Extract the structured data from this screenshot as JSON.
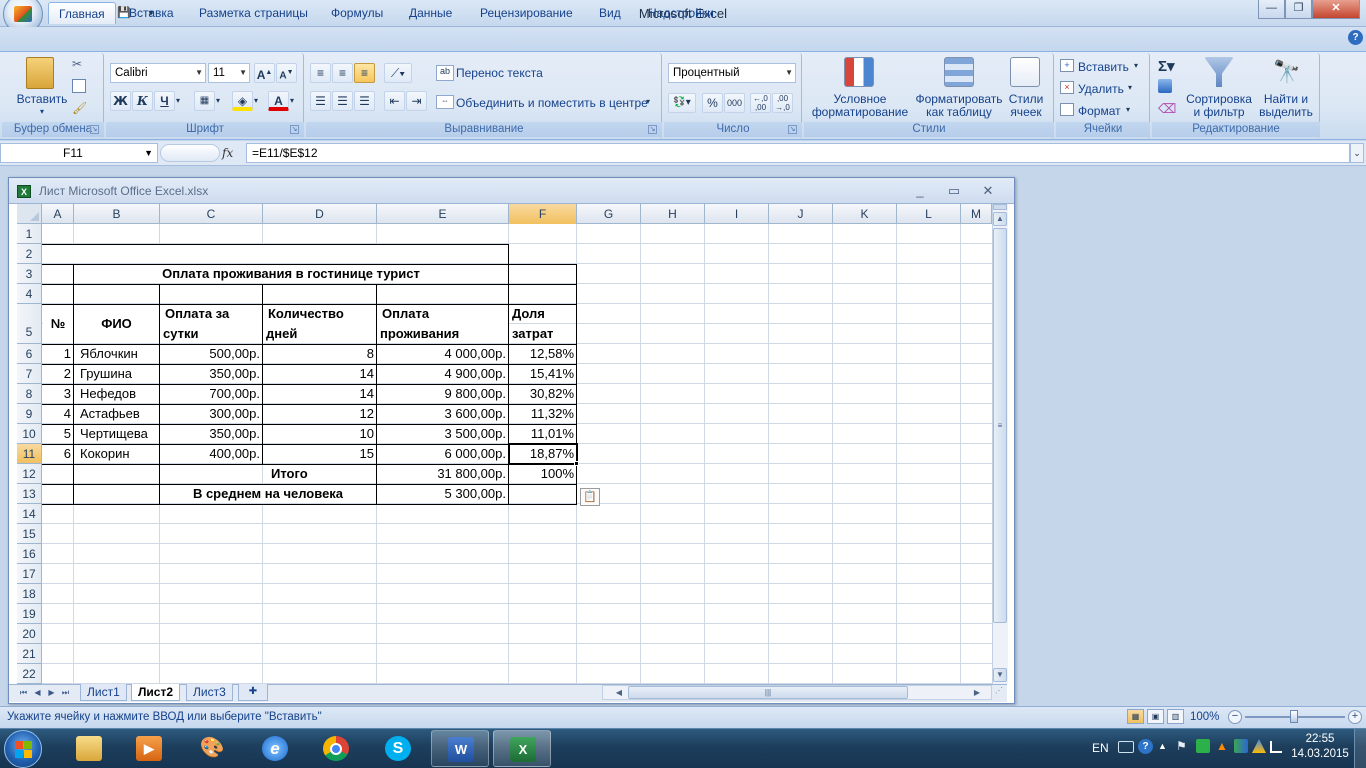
{
  "app": {
    "title": "Microsoft Excel",
    "qat": {
      "undo": "↶",
      "redo": "↷",
      "save": "💾",
      "more": "▾"
    },
    "window_buttons": {
      "minimize": "—",
      "restore": "❐",
      "close": "✕"
    }
  },
  "ribbon": {
    "tabs": [
      "Главная",
      "Вставка",
      "Разметка страницы",
      "Формулы",
      "Данные",
      "Рецензирование",
      "Вид",
      "Надстройки"
    ],
    "active_tab": "Главная",
    "clipboard": {
      "label": "Буфер обмена",
      "paste": "Вставить"
    },
    "font": {
      "label": "Шрифт",
      "name": "Calibri",
      "size": "11",
      "bold": "Ж",
      "italic": "К",
      "underline": "Ч"
    },
    "alignment": {
      "label": "Выравнивание",
      "wrap": "Перенос текста",
      "merge": "Объединить и поместить в центре"
    },
    "number": {
      "label": "Число",
      "format": "Процентный",
      "percent": "%",
      "thousands": "000"
    },
    "styles": {
      "label": "Стили",
      "conditional": "Условное форматирование",
      "as_table": "Форматировать как таблицу",
      "cell_styles": "Стили ячеек"
    },
    "cells": {
      "label": "Ячейки",
      "insert": "Вставить",
      "delete": "Удалить",
      "format": "Формат"
    },
    "editing": {
      "label": "Редактирование",
      "sort": "Сортировка и фильтр",
      "find": "Найти и выделить"
    }
  },
  "formula_bar": {
    "name_box": "F11",
    "fx": "fx",
    "formula": "=E11/$E$12"
  },
  "workbook": {
    "title": "Лист Microsoft Office Excel.xlsx",
    "columns": [
      "A",
      "B",
      "C",
      "D",
      "E",
      "F",
      "G",
      "H",
      "I",
      "J",
      "K",
      "L",
      "M"
    ],
    "rows": [
      "1",
      "2",
      "3",
      "4",
      "5",
      "6",
      "7",
      "8",
      "9",
      "10",
      "11",
      "12",
      "13",
      "14",
      "15",
      "16",
      "17",
      "18",
      "19",
      "20",
      "21",
      "22"
    ],
    "selected_cell": "F11",
    "table": {
      "title": "Оплата проживания в гостинице турист",
      "headers": {
        "num": "№",
        "fio": "ФИО",
        "pay_day_1": "Оплата за",
        "pay_day_2": "сутки",
        "days_1": "Количество",
        "days_2": "дней",
        "pay_total_1": "Оплата",
        "pay_total_2": "проживания",
        "share_1": "Доля",
        "share_2": "затрат"
      },
      "records": [
        {
          "num": "1",
          "fio": "Яблочкин",
          "per_day": "500,00р.",
          "days": "8",
          "total": "4 000,00р.",
          "share": "12,58%"
        },
        {
          "num": "2",
          "fio": "Грушина",
          "per_day": "350,00р.",
          "days": "14",
          "total": "4 900,00р.",
          "share": "15,41%"
        },
        {
          "num": "3",
          "fio": "Нефедов",
          "per_day": "700,00р.",
          "days": "14",
          "total": "9 800,00р.",
          "share": "30,82%"
        },
        {
          "num": "4",
          "fio": "Астафьев",
          "per_day": "300,00р.",
          "days": "12",
          "total": "3 600,00р.",
          "share": "11,32%"
        },
        {
          "num": "5",
          "fio": "Чертищева",
          "per_day": "350,00р.",
          "days": "10",
          "total": "3 500,00р.",
          "share": "11,01%"
        },
        {
          "num": "6",
          "fio": "Кокорин",
          "per_day": "400,00р.",
          "days": "15",
          "total": "6 000,00р.",
          "share": "18,87%"
        }
      ],
      "total_label": "Итого",
      "total_value": "31 800,00р.",
      "total_share": "100%",
      "avg_label": "В среднем на человека",
      "avg_value": "5 300,00р."
    },
    "sheets": [
      "Лист1",
      "Лист2",
      "Лист3"
    ],
    "active_sheet": "Лист2"
  },
  "status": {
    "message": "Укажите ячейку и нажмите ВВОД или выберите \"Вставить\"",
    "zoom": "100%"
  },
  "taskbar": {
    "language": "EN",
    "time": "22:55",
    "date": "14.03.2015",
    "apps": [
      "explorer",
      "media-player",
      "paint",
      "internet-explorer",
      "chrome",
      "skype",
      "word",
      "excel"
    ]
  },
  "colors": {
    "accent": "#15428b",
    "selection": "#f1c15f",
    "excel_green": "#1f7a3a"
  }
}
